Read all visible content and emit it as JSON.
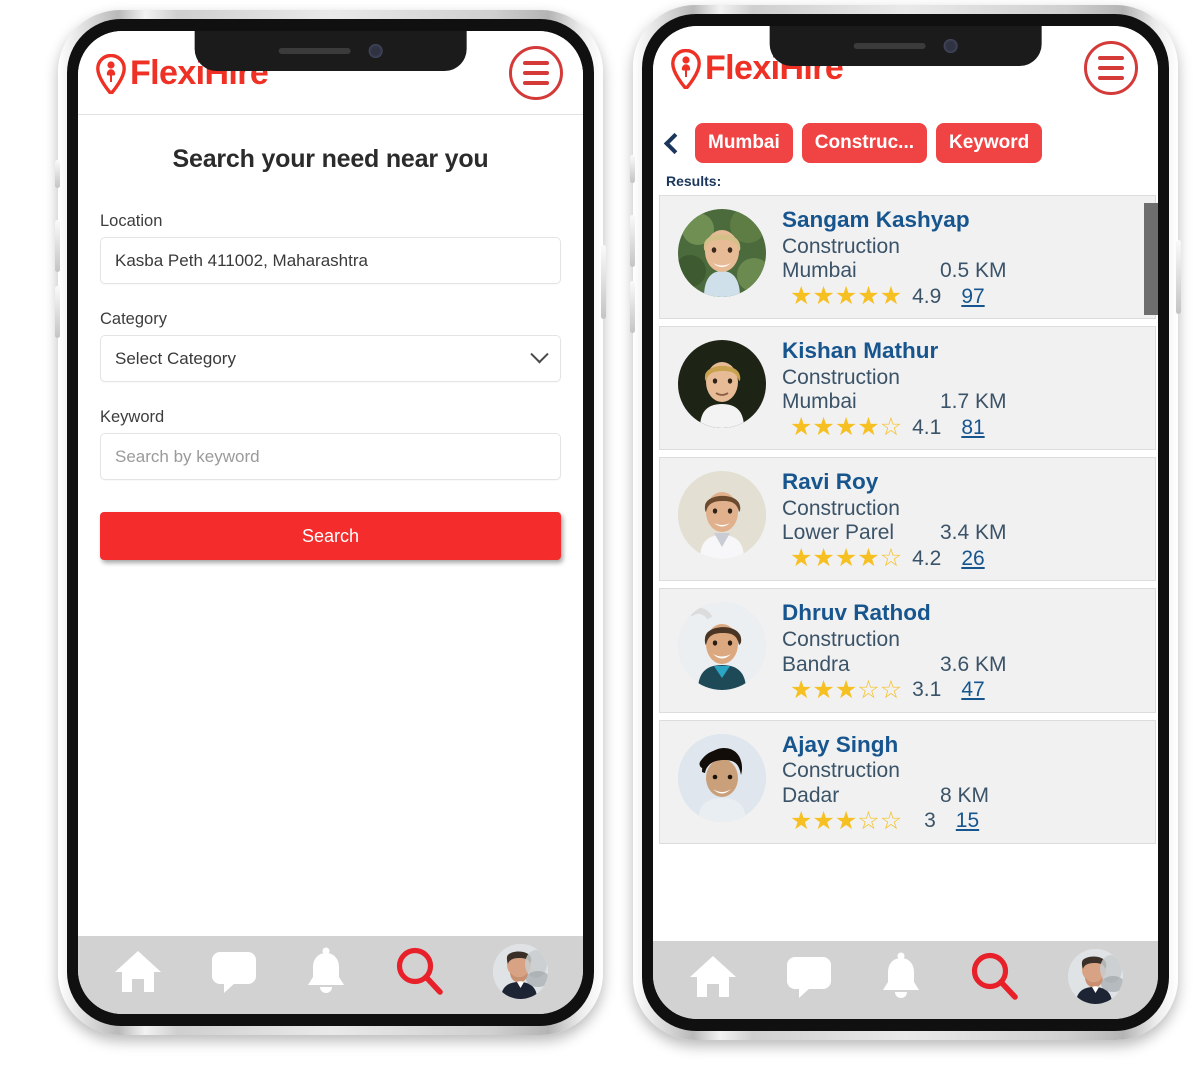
{
  "brand": {
    "name": "FlexiHire",
    "logo_icon": "map-pin-person-icon",
    "accent_color": "#EE3124"
  },
  "menu": {
    "icon": "hamburger-menu-icon"
  },
  "phone1": {
    "screen_title": "Search your need near you",
    "fields": {
      "location": {
        "label": "Location",
        "value": "Kasba Peth 411002, Maharashtra",
        "placeholder": "Location"
      },
      "category": {
        "label": "Category",
        "value": "Select Category",
        "chevron_icon": "chevron-down-icon"
      },
      "keyword": {
        "label": "Keyword",
        "value": "",
        "placeholder": "Search by keyword"
      }
    },
    "search_button": {
      "label": "Search",
      "color": "#F52C2C"
    }
  },
  "phone2": {
    "back_icon": "chevron-left-icon",
    "filter_chips": [
      {
        "label": "Mumbai"
      },
      {
        "label": "Construc..."
      },
      {
        "label": "Keyword"
      }
    ],
    "chip_color": "#F04343",
    "results_label": "Results:",
    "scrollbar": {
      "position": "top",
      "color": "#6e6e6e"
    },
    "results": [
      {
        "name": "Sangam Kashyap",
        "category": "Construction",
        "city": "Mumbai",
        "distance": "0.5 KM",
        "rating": "4.9",
        "stars_filled": 5,
        "reviews": "97"
      },
      {
        "name": "Kishan Mathur",
        "category": "Construction",
        "city": "Mumbai",
        "distance": "1.7 KM",
        "rating": "4.1",
        "stars_filled": 4,
        "reviews": "81"
      },
      {
        "name": "Ravi Roy",
        "category": "Construction",
        "city": "Lower Parel",
        "distance": "3.4 KM",
        "rating": "4.2",
        "stars_filled": 4,
        "reviews": "26"
      },
      {
        "name": "Dhruv Rathod",
        "category": "Construction",
        "city": "Bandra",
        "distance": "3.6 KM",
        "rating": "3.1",
        "stars_filled": 3,
        "reviews": "47"
      },
      {
        "name": "Ajay Singh",
        "category": "Construction",
        "city": "Dadar",
        "distance": "8 KM",
        "rating": "3",
        "stars_filled": 3,
        "reviews": "15"
      }
    ]
  },
  "bottom_nav": {
    "items": [
      {
        "icon": "home-icon",
        "active": false
      },
      {
        "icon": "chat-bubble-icon",
        "active": false
      },
      {
        "icon": "bell-icon",
        "active": false
      },
      {
        "icon": "search-icon",
        "active": true
      },
      {
        "icon": "profile-avatar-icon",
        "active": false
      }
    ],
    "active_color": "#E8202A"
  }
}
